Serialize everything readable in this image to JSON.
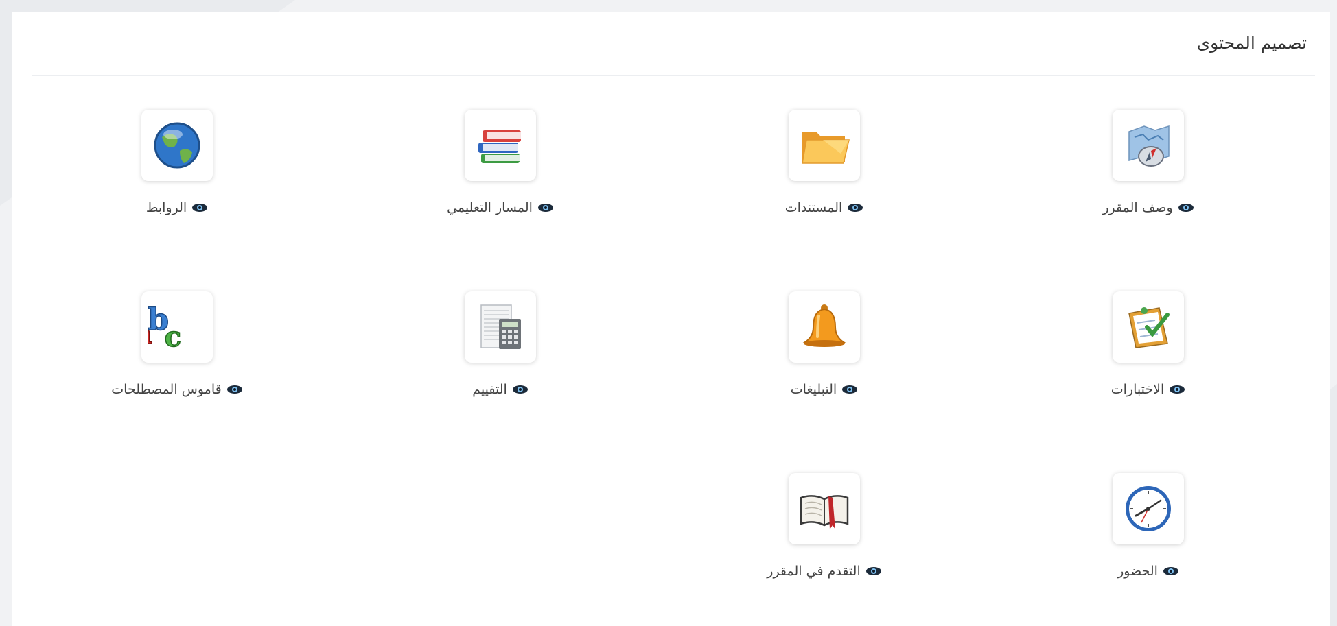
{
  "section": {
    "title": "تصميم المحتوى"
  },
  "tools": [
    {
      "id": "course-description",
      "label": "وصف المقرر",
      "icon": "compass-map-icon"
    },
    {
      "id": "documents",
      "label": "المستندات",
      "icon": "folder-icon"
    },
    {
      "id": "learning-path",
      "label": "المسار التعليمي",
      "icon": "books-icon"
    },
    {
      "id": "links",
      "label": "الروابط",
      "icon": "globe-icon"
    },
    {
      "id": "tests",
      "label": "الاختبارات",
      "icon": "checklist-icon"
    },
    {
      "id": "announcements",
      "label": "التبليغات",
      "icon": "bell-icon"
    },
    {
      "id": "gradebook",
      "label": "التقييم",
      "icon": "calculator-icon"
    },
    {
      "id": "glossary",
      "label": "قاموس المصطلحات",
      "icon": "abc-icon"
    },
    {
      "id": "attendance",
      "label": "الحضور",
      "icon": "clock-icon"
    },
    {
      "id": "course-progress",
      "label": "التقدم في المقرر",
      "icon": "open-book-icon"
    }
  ],
  "visibility_icon": "eye-icon",
  "colors": {
    "background": "#f1f2f4",
    "panel": "#ffffff",
    "text": "#333333",
    "divider": "#eceef1"
  }
}
